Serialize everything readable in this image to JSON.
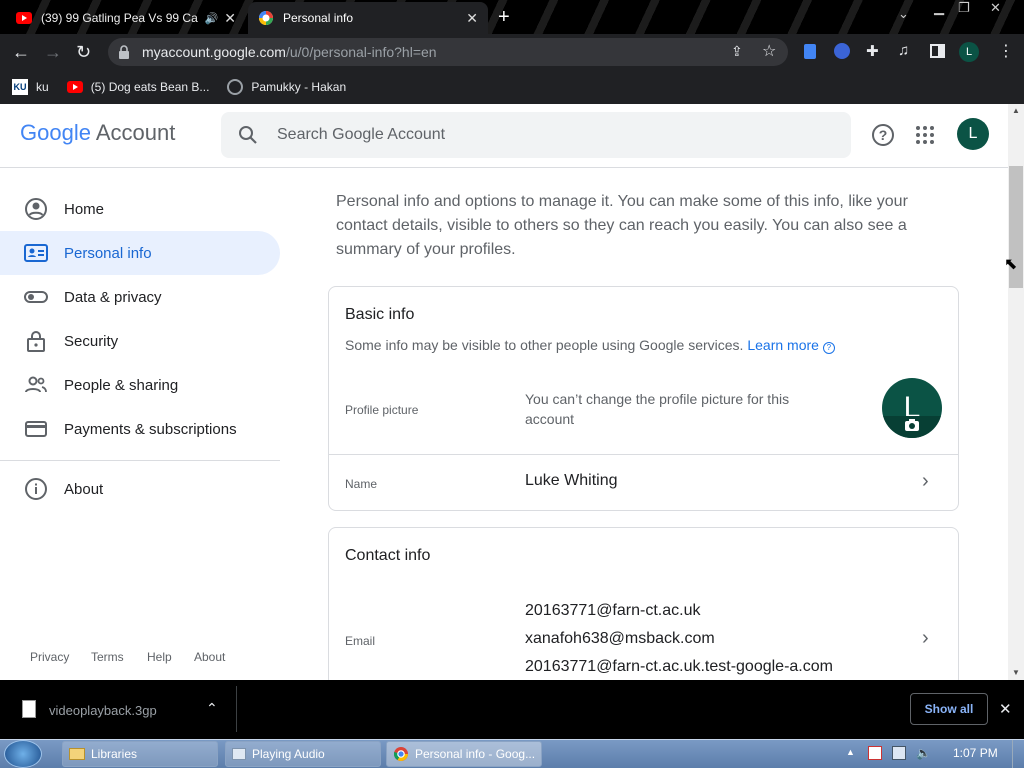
{
  "browser": {
    "tabs": [
      {
        "title": "(39) 99 Gatling Pea Vs 99 Ca"
      },
      {
        "title": "Personal info"
      }
    ],
    "url_host": "myaccount.google.com",
    "url_path": "/u/0/personal-info?hl=en",
    "profile_letter": "L",
    "bookmarks": [
      {
        "label": "ku"
      },
      {
        "label": "(5) Dog eats Bean B..."
      },
      {
        "label": "Pamukky - Hakan"
      }
    ]
  },
  "header": {
    "logo_google": "Google",
    "logo_account": "Account",
    "search_placeholder": "Search Google Account",
    "avatar_letter": "L"
  },
  "sidebar": {
    "items": [
      {
        "label": "Home"
      },
      {
        "label": "Personal info"
      },
      {
        "label": "Data & privacy"
      },
      {
        "label": "Security"
      },
      {
        "label": "People & sharing"
      },
      {
        "label": "Payments & subscriptions"
      },
      {
        "label": "About"
      }
    ],
    "footer": [
      "Privacy",
      "Terms",
      "Help",
      "About"
    ]
  },
  "main": {
    "intro": "Personal info and options to manage it. You can make some of this info, like your contact details, visible to others so they can reach you easily. You can also see a summary of your profiles.",
    "basic_info": {
      "title": "Basic info",
      "subtitle": "Some info may be visible to other people using Google services.",
      "learn_more": "Learn more",
      "profile_label": "Profile picture",
      "profile_value": "You can’t change the profile picture for this account",
      "profile_letter": "L",
      "name_label": "Name",
      "name_value": "Luke Whiting"
    },
    "contact_info": {
      "title": "Contact info",
      "email_label": "Email",
      "emails": [
        "20163771@farn-ct.ac.uk",
        "xanafoh638@msback.com",
        "20163771@farn-ct.ac.uk.test-google-a.com"
      ]
    }
  },
  "download_bar": {
    "filename": "videoplayback.3gp",
    "show_all": "Show all"
  },
  "taskbar": {
    "items": [
      {
        "label": "Libraries"
      },
      {
        "label": "Playing Audio"
      },
      {
        "label": "Personal info - Goog..."
      }
    ],
    "clock": "1:07 PM"
  }
}
